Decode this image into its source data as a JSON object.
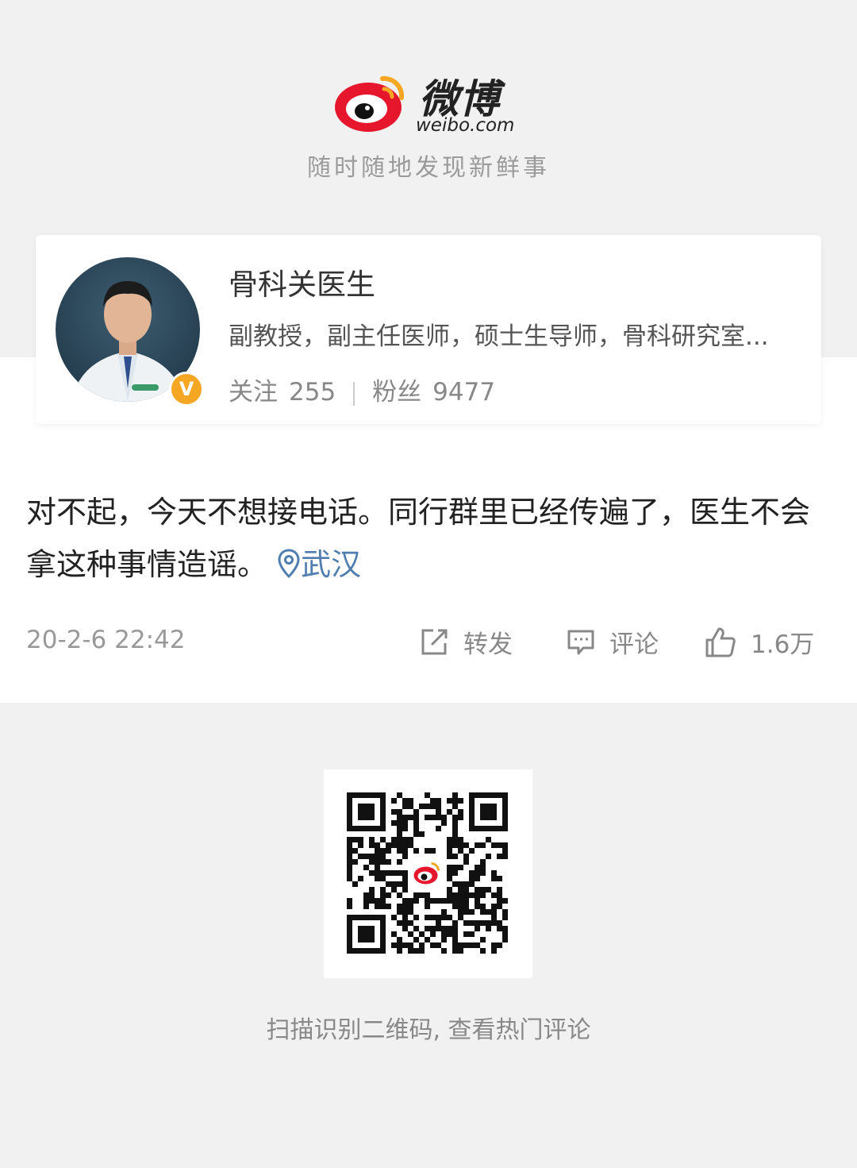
{
  "brand": {
    "logo_cn": "微博",
    "logo_en": "weibo.com",
    "slogan": "随时随地发现新鲜事",
    "colors": {
      "red": "#e6162d",
      "orange": "#f5a623",
      "link": "#507daf"
    }
  },
  "profile": {
    "name": "骨科关医生",
    "bio": "副教授，副主任医师，硕士生导师，骨科研究室...",
    "follow_label": "关注",
    "follow_count": "255",
    "fans_label": "粉丝",
    "fans_count": "9477",
    "verified_badge": "V"
  },
  "post": {
    "text": "对不起，今天不想接电话。同行群里已经传遍了，医生不会拿这种事情造谣。",
    "location": "武汉",
    "timestamp": "20-2-6 22:42",
    "repost_label": "转发",
    "comment_label": "评论",
    "like_count": "1.6万"
  },
  "footer": {
    "qr_caption": "扫描识别二维码, 查看热门评论"
  }
}
